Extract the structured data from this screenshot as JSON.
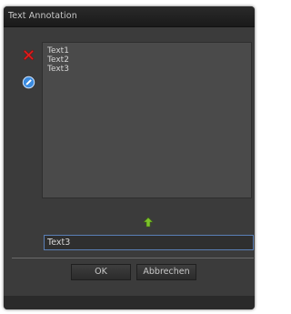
{
  "window": {
    "title": "Text Annotation"
  },
  "toolbar": {
    "delete_icon": "red-x-delete-icon",
    "edit_icon": "blue-edit-icon"
  },
  "list": {
    "items": [
      "Text1",
      "Text2",
      "Text3"
    ]
  },
  "move_up_icon": "green-up-arrow-icon",
  "input": {
    "value": "Text3"
  },
  "buttons": {
    "ok_label": "OK",
    "cancel_label": "Abbrechen"
  },
  "colors": {
    "window_bg": "#3b3b3b",
    "input_border": "#5a7fb5",
    "delete_red": "#e02020",
    "edit_blue": "#3a8be0",
    "arrow_green": "#7cc32a"
  }
}
